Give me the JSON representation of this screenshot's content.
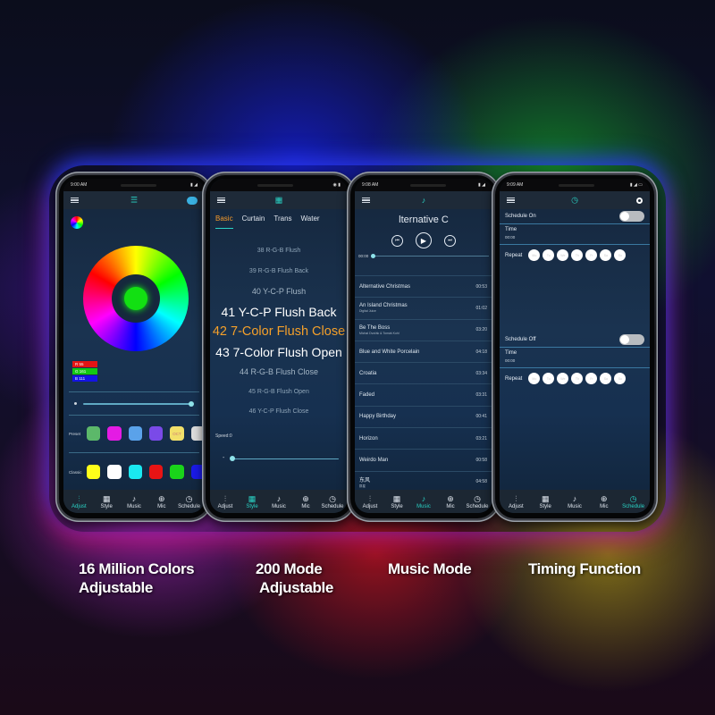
{
  "colors": {
    "accent": "#2ad4c6",
    "mode_selected": "#f5a02a",
    "tab_active_style": "#f59a2a"
  },
  "nav_tabs": [
    "Adjust",
    "Style",
    "Music",
    "Mic",
    "Schedule"
  ],
  "nav_icons": [
    "sliders-icon",
    "grid-icon",
    "music-icon",
    "mic-icon",
    "timer-icon"
  ],
  "phones": [
    {
      "status_time": "9:00 AM",
      "active_tab": "Adjust",
      "rgb": {
        "r": "R 55",
        "g": "G 161",
        "b": "B 111"
      },
      "preset_label": "Preset",
      "preset_swatches": [
        "#5cb86a",
        "#e41be4",
        "#5aa2ea",
        "#7a4ae8",
        "#f2e06a",
        "#dddddd"
      ],
      "preset_badge": "OCT",
      "classic_label": "Classic",
      "classic_swatches": [
        "#ffff1a",
        "#ffffff",
        "#1ae8f0",
        "#e81414",
        "#1ad41a",
        "#1a1ae8"
      ],
      "brightness": 1.0
    },
    {
      "active_tab": "Style",
      "mode_tabs": [
        "Basic",
        "Curtain",
        "Trans",
        "Water"
      ],
      "mode_tab_selected": "Basic",
      "modes": [
        "38 R-G-B Flush",
        "39 R-G-B Flush Back",
        "40 Y-C-P Flush",
        "41 Y-C-P Flush Back",
        "42 7-Color Flush Close",
        "43 7-Color Flush Open",
        "44 R-G-B Flush Close",
        "45 R-G-B Flush Open",
        "46 Y-C-P Flush Close"
      ],
      "selected_mode": "42 7-Color Flush Close",
      "speed_label": "Speed:0",
      "speed_minus": "-",
      "speed": 0
    },
    {
      "status_time": "9:08 AM",
      "active_tab": "Music",
      "now_playing": "lternative C",
      "elapsed": "00:00",
      "songs": [
        {
          "title": "Alternative Christmas",
          "artist": "",
          "duration": "00:53"
        },
        {
          "title": "An Island Christmas",
          "artist": "Digital Juice",
          "duration": "01:02"
        },
        {
          "title": "Be The Boss",
          "artist": "Michal Dvořák & Tomáš Kohl",
          "duration": "03:20"
        },
        {
          "title": "Blue and White Porcelain",
          "artist": "",
          "duration": "04:18"
        },
        {
          "title": "Croatia",
          "artist": "",
          "duration": "03:34"
        },
        {
          "title": "Faded",
          "artist": "",
          "duration": "03:31"
        },
        {
          "title": "Happy Birthday",
          "artist": "",
          "duration": "00:41"
        },
        {
          "title": "Horizon",
          "artist": "",
          "duration": "03:21"
        },
        {
          "title": "Weirdo Man",
          "artist": "",
          "duration": "00:58"
        },
        {
          "title": "东风",
          "artist": "群星",
          "duration": "04:58"
        }
      ]
    },
    {
      "status_time": "9:09 AM",
      "active_tab": "Schedule",
      "schedule_on_label": "Schedule On",
      "schedule_off_label": "Schedule Off",
      "time_label": "Time",
      "on_time": "00:00",
      "off_time": "00:00",
      "repeat_label": "Repeat",
      "days": [
        "Mo",
        "Tu",
        "We",
        "Th",
        "Fr",
        "Sa",
        "Su"
      ]
    }
  ],
  "captions": [
    [
      "16 Million Colors",
      "Adjustable"
    ],
    [
      "200 Mode",
      "Adjustable"
    ],
    [
      "Music Mode",
      ""
    ],
    [
      "Timing Function",
      ""
    ]
  ]
}
